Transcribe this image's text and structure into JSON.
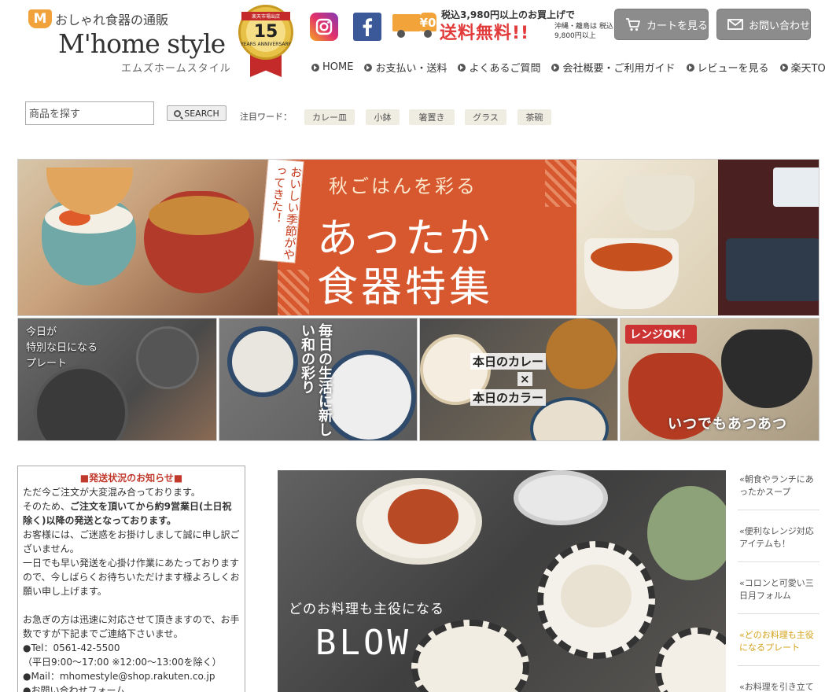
{
  "header": {
    "logo_mark": "M",
    "logo_tagline": "おしゃれ食器の通販",
    "logo_title": "M'home style",
    "logo_kana": "エムズホームスタイル",
    "badge_top": "楽天市場出店",
    "badge_number": "15",
    "badge_years": "YEARS ANNIVERSARY",
    "shipping_line1": "税込3,980円以上のお買上げで",
    "shipping_line2": "送料無料!!",
    "shipping_note": "沖縄・離島は 税込9,800円以上",
    "shipping_yen": "¥0",
    "cart_button": "カートを見る",
    "contact_button": "お問い合わせ"
  },
  "topnav": [
    {
      "label": "HOME"
    },
    {
      "label": "お支払い・送料"
    },
    {
      "label": "よくあるご質問"
    },
    {
      "label": "会社概要・ご利用ガイド"
    },
    {
      "label": "レビューを見る"
    },
    {
      "label": "楽天TOP"
    }
  ],
  "search": {
    "placeholder": "商品を探す",
    "button": "SEARCH",
    "keywords_label": "注目ワード：",
    "keywords": [
      "カレー皿",
      "小鉢",
      "箸置き",
      "グラス",
      "茶碗"
    ]
  },
  "hero": {
    "tag": "おいしい季節がやってきた！",
    "subtitle": "秋ごはんを彩る",
    "title_line1": "あったか",
    "title_line2": "食器特集"
  },
  "subbanners": {
    "b1_text": "今日が\n特別な日になる\nプレート",
    "b2_text": "毎日の生活に新しい和の彩り",
    "b3_line1": "本日のカレー",
    "b3_x": "×",
    "b3_line2": "本日のカラー",
    "b4_badge": "レンジOK！",
    "b4_text": "いつでもあつあつ"
  },
  "notice": {
    "title": "■発送状況のお知らせ■",
    "p1": "ただ今ご注文が大変混み合っております。",
    "p2_prefix": "そのため、",
    "p2_bold": "ご注文を頂いてから約9営業日(土日祝除く)以降の発送となっております。",
    "p3": "お客様には、ご迷惑をお掛けしまして誠に申し訳ございません。",
    "p4": "一日でも早い発送を心掛け作業にあたっておりますので、今しばらくお待ちいただけます様よろしくお願い申し上げます。",
    "p5": "お急ぎの方は迅速に対応させて頂きますので、お手数ですが下記までご連絡下さいませ。",
    "tel": "●Tel：0561-42-5500",
    "hours": "（平日9:00～17:00 ※12:00～13:00を除く）",
    "mail": "●Mail：mhomestyle@shop.rakuten.co.jp",
    "form": "●お問い合わせフォーム"
  },
  "main": {
    "caption": "どのお料理も主役になる",
    "brand": "BLOW"
  },
  "side_links": [
    {
      "label": "«朝食やランチにあったかスープ",
      "active": false
    },
    {
      "label": "«便利なレンジ対応アイテムも！",
      "active": false
    },
    {
      "label": "«コロンと可愛い三日月フォルム",
      "active": false
    },
    {
      "label": "«どのお料理も主役になるプレート",
      "active": true
    },
    {
      "label": "«お料理を引き立て",
      "active": false
    }
  ],
  "colors": {
    "accent_red": "#e23b3b",
    "hero_orange": "#d7572f",
    "button_gray": "#8c8c8c",
    "active_link": "#d4a21b"
  }
}
